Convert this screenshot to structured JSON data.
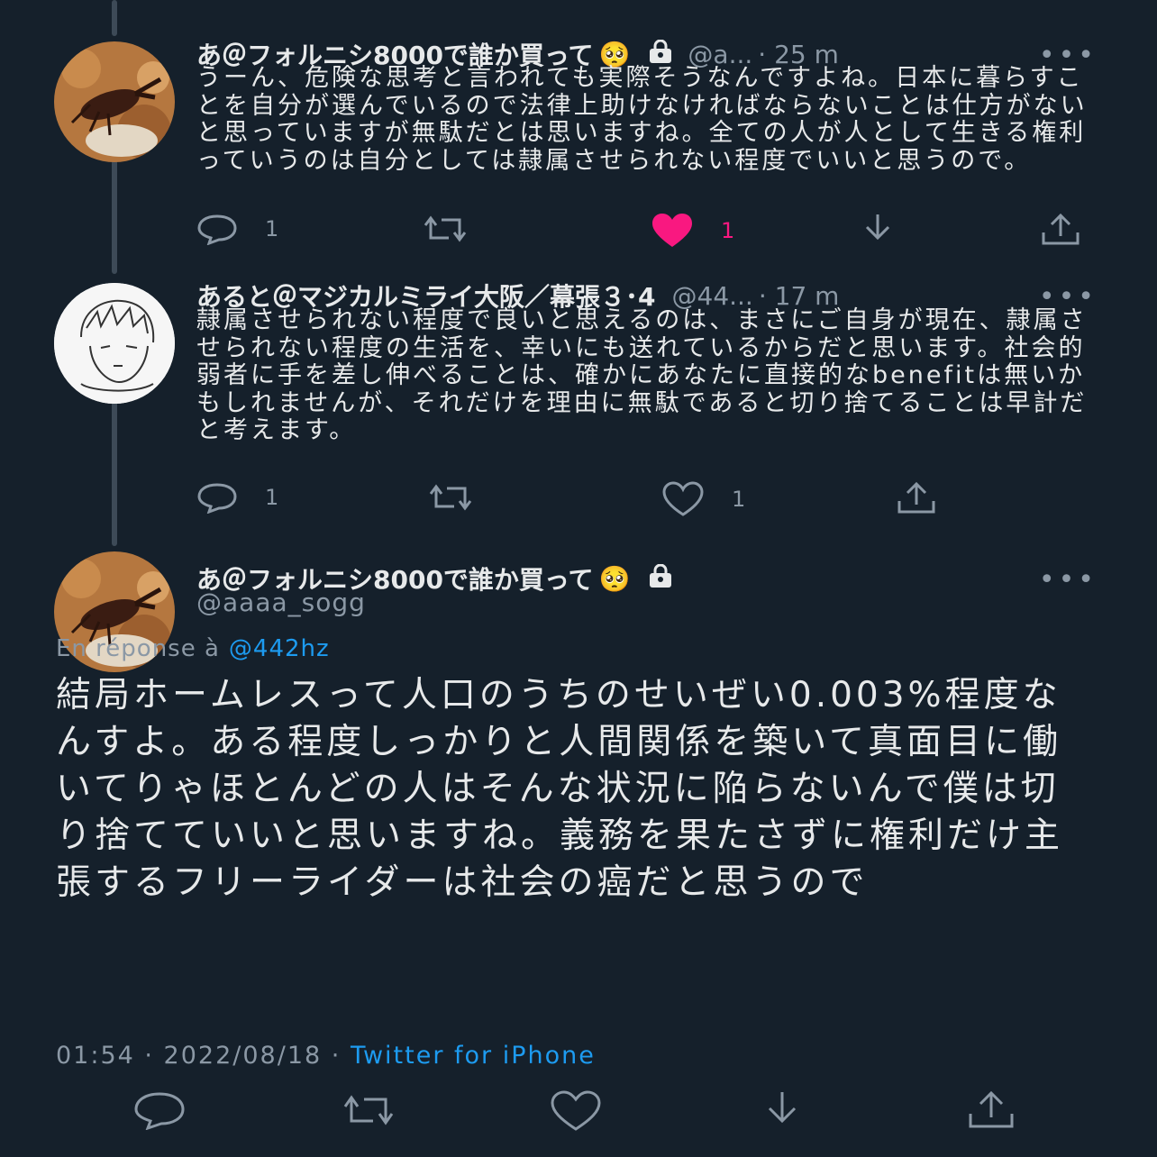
{
  "tweets": [
    {
      "name": "あ＠フォルニシ8000で誰か買って",
      "emoji": "🥺",
      "handle": "@a...",
      "time": "· 25 m",
      "more": "•••",
      "text": "うーん、危険な思考と言われても実際そうなんですよね。日本に暮らすことを自分が選んでいるので法律上助けなければならないことは仕方がないと思っていますが無駄だとは思いますね。全ての人が人として生きる権利っていうのは自分としては隷属させられない程度でいいと思うので。",
      "replies": "1",
      "retweets": "",
      "likes": "1",
      "liked": true
    },
    {
      "name": "あると＠マジカルミライ大阪／幕張３･4",
      "handle": "@44...",
      "time": "· 17 m",
      "more": "•••",
      "text": "隷属させられない程度で良いと思えるのは、まさにご自身が現在、隷属させられない程度の生活を、幸いにも送れているからだと思います。社会的弱者に手を差し伸べることは、確かにあなたに直接的なbenefitは無いかもしれませんが、それだけを理由に無駄であると切り捨てることは早計だと考えます。",
      "replies": "1",
      "retweets": "",
      "likes": "1",
      "liked": false
    }
  ],
  "main": {
    "name": "あ＠フォルニシ8000で誰か買って",
    "emoji": "🥺",
    "handle": "@aaaa_sogg",
    "more": "•••",
    "reply_prefix": "En réponse à",
    "reply_to": "@442hz",
    "text": "結局ホームレスって人口のうちのせいぜい0.003%程度なんすよ。ある程度しっかりと人間関係を築いて真面目に働いてりゃほとんどの人はそんな状況に陥らないんで僕は切り捨てていいと思いますね。義務を果たさずに権利だけ主張するフリーライダーは社会の癌だと思うので",
    "datetime": "01:54 · 2022/08/18 ·",
    "source": "Twitter for iPhone"
  },
  "colors": {
    "background": "#15202b",
    "text": "#e7e9ea",
    "muted": "#8b98a5",
    "link": "#1d9bf0",
    "like": "#f91880"
  }
}
